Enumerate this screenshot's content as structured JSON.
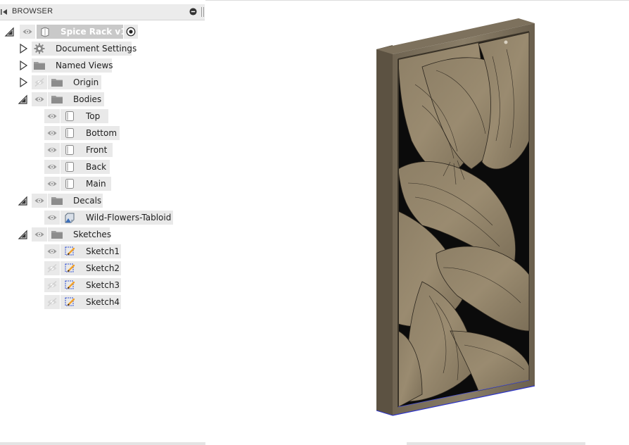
{
  "browser": {
    "title": "BROWSER",
    "root": {
      "label": "Spice Rack v1"
    },
    "items": [
      {
        "label": "Document Settings"
      },
      {
        "label": "Named Views"
      },
      {
        "label": "Origin"
      },
      {
        "label": "Bodies"
      },
      {
        "label": "Top"
      },
      {
        "label": "Bottom"
      },
      {
        "label": "Front"
      },
      {
        "label": "Back"
      },
      {
        "label": "Main"
      },
      {
        "label": "Decals"
      },
      {
        "label": "Wild-Flowers-Tabloid"
      },
      {
        "label": "Sketches"
      },
      {
        "label": "Sketch1"
      },
      {
        "label": "Sketch2"
      },
      {
        "label": "Sketch3"
      },
      {
        "label": "Sketch4"
      }
    ]
  },
  "colors": {
    "wood": "#8a7b63",
    "wood_dark": "#4e4536",
    "engraving_bg": "#0b0b0b",
    "selection": "#c9c9c9",
    "edge_highlight": "#2e35c8"
  }
}
